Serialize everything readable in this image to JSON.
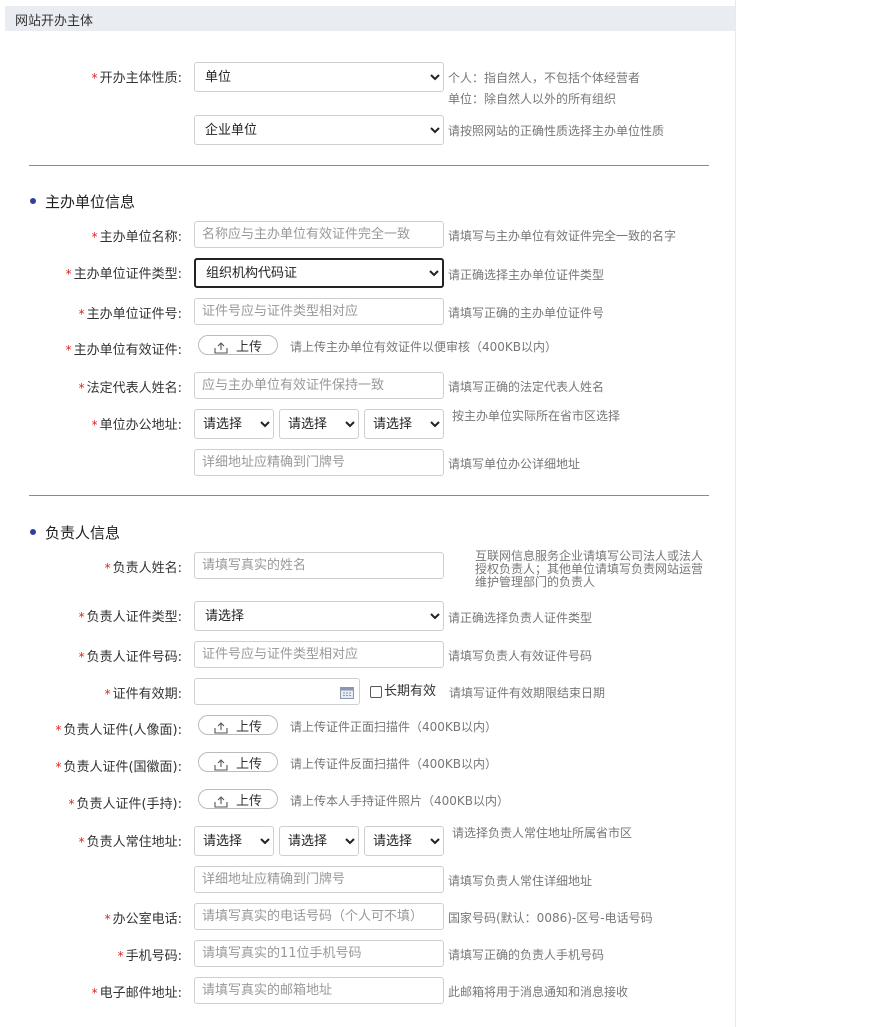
{
  "header": {
    "title": "网站开办主体"
  },
  "required_mark": "*",
  "nature": {
    "label": "开办主体性质:",
    "value": "单位",
    "hint1": "个人：指自然人，不包括个体经营者",
    "hint2": "单位：除自然人以外的所有组织",
    "sub_value": "企业单位",
    "sub_hint": "请按照网站的正确性质选择主办单位性质"
  },
  "org_section": {
    "title": "主办单位信息",
    "name": {
      "label": "主办单位名称:",
      "placeholder": "名称应与主办单位有效证件完全一致",
      "hint": "请填写与主办单位有效证件完全一致的名字"
    },
    "cert_type": {
      "label": "主办单位证件类型:",
      "value": "组织机构代码证",
      "hint": "请正确选择主办单位证件类型"
    },
    "cert_no": {
      "label": "主办单位证件号:",
      "placeholder": "证件号应与证件类型相对应",
      "hint": "请填写正确的主办单位证件号"
    },
    "cert_file": {
      "label": "主办单位有效证件:",
      "button": "上传",
      "hint": "请上传主办单位有效证件以便审核（400KB以内）"
    },
    "legal_rep": {
      "label": "法定代表人姓名:",
      "placeholder": "应与主办单位有效证件保持一致",
      "hint": "请填写正确的法定代表人姓名"
    },
    "address": {
      "label": "单位办公地址:",
      "province": "请选择",
      "city": "请选择",
      "district": "请选择",
      "hint": "按主办单位实际所在省市区选择",
      "detail_placeholder": "详细地址应精确到门牌号",
      "detail_hint": "请填写单位办公详细地址"
    }
  },
  "person_section": {
    "title": "负责人信息",
    "name": {
      "label": "负责人姓名:",
      "placeholder": "请填写真实的姓名",
      "hint_lines": [
        "互联网信息服务企业请填写公司法人或法人",
        "授权负责人；其他单位请填写负责网站运营",
        "维护管理部门的负责人"
      ]
    },
    "cert_type": {
      "label": "负责人证件类型:",
      "value": "请选择",
      "hint": "请正确选择负责人证件类型"
    },
    "cert_no": {
      "label": "负责人证件号码:",
      "placeholder": "证件号应与证件类型相对应",
      "hint": "请填写负责人有效证件号码"
    },
    "validity": {
      "label": "证件有效期:",
      "value": "",
      "checkbox_label": "长期有效",
      "hint": "请填写证件有效期限结束日期"
    },
    "front": {
      "label": "负责人证件(人像面):",
      "button": "上传",
      "hint": "请上传证件正面扫描件（400KB以内）"
    },
    "back": {
      "label": "负责人证件(国徽面):",
      "button": "上传",
      "hint": "请上传证件反面扫描件（400KB以内）"
    },
    "handheld": {
      "label": "负责人证件(手持):",
      "button": "上传",
      "hint": "请上传本人手持证件照片（400KB以内）"
    },
    "address": {
      "label": "负责人常住地址:",
      "province": "请选择",
      "city": "请选择",
      "district": "请选择",
      "hint": "请选择负责人常住地址所属省市区",
      "detail_placeholder": "详细地址应精确到门牌号",
      "detail_hint": "请填写负责人常住详细地址"
    },
    "office_phone": {
      "label": "办公室电话:",
      "placeholder": "请填写真实的电话号码（个人可不填）",
      "hint": "国家号码(默认：0086)-区号-电话号码"
    },
    "mobile": {
      "label": "手机号码:",
      "placeholder": "请填写真实的11位手机号码",
      "hint": "请填写正确的负责人手机号码"
    },
    "email": {
      "label": "电子邮件地址:",
      "placeholder": "请填写真实的邮箱地址",
      "hint": "此邮箱将用于消息通知和消息接收"
    }
  },
  "colors": {
    "required": "#e02020",
    "section_dot": "#2e3f9e",
    "hint": "#777777",
    "header_bg": "#e9ecf1"
  },
  "icons": {
    "upload": "upload-icon",
    "calendar": "calendar-icon"
  }
}
